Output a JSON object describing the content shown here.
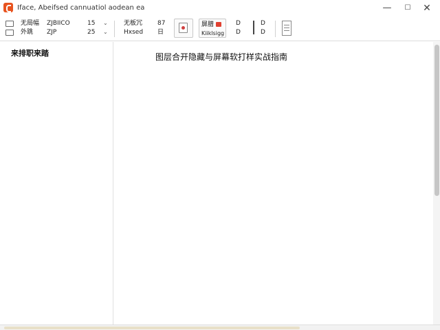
{
  "window": {
    "title": "Iface, Abeifsed cannuatiol aodean ea",
    "minimize": "—",
    "maximize": "☐",
    "close": "✕"
  },
  "toolbar": {
    "row1_label": "无局幅",
    "row2_label": "外跳",
    "row1_code": "ZJBIICO",
    "row2_code": "ZJP",
    "row1_num": "15",
    "row2_num": "25",
    "group2_row1": "无板冗",
    "group2_row2": "Hxsed",
    "group2_val1": "87",
    "group2_val2": "日",
    "style_row1": "屏腊",
    "style_row2": "Kiiklsigg",
    "square_glyph": "D"
  },
  "sidebar": {
    "heading": "来排职来踏"
  },
  "document": {
    "title": "图层合开隐藏与屏幕软打样实战指南"
  },
  "colors": {
    "app_accent": "#e8531f"
  }
}
